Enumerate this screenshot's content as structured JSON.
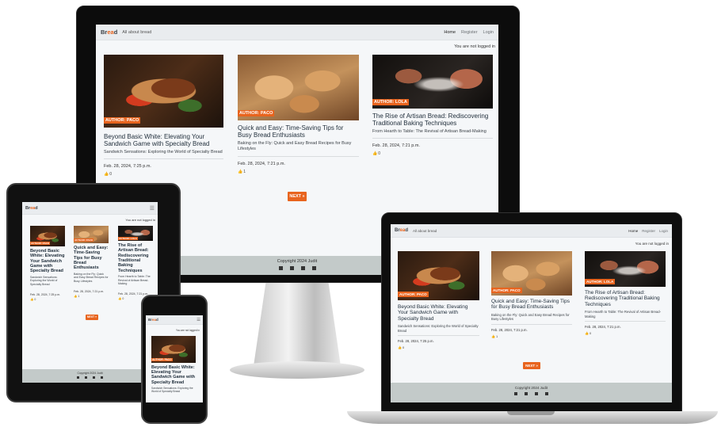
{
  "site": {
    "brand_prefix": "Br",
    "brand_accent": "ea",
    "brand_suffix": "d",
    "tagline": "All about bread",
    "nav": [
      "Home",
      "Register",
      "Login"
    ],
    "login_status": "You are not logged in",
    "next_label": "NEXT »",
    "footer_text": "Copyright 2024 Judit",
    "accent_color": "#e8641e",
    "social_icons": [
      "facebook-icon",
      "instagram-icon",
      "youtube-icon",
      "linkedin-icon"
    ]
  },
  "posts": [
    {
      "author": "AUTHOR: PACO",
      "title": "Beyond Basic White: Elevating Your Sandwich Game with Specialty Bread",
      "excerpt": "Sandwich Sensations: Exploring the World of Specialty Bread",
      "date": "Feb. 28, 2024, 7:25 p.m.",
      "likes": "0",
      "image": "sandwich"
    },
    {
      "author": "AUTHOR: PACO",
      "title": "Quick and Easy: Time-Saving Tips for Busy Bread Enthusiasts",
      "excerpt": "Baking on the Fly: Quick and Easy Bread Recipes for Busy Lifestyles",
      "date": "Feb. 28, 2024, 7:21 p.m.",
      "likes": "1",
      "image": "bread"
    },
    {
      "author": "AUTHOR: LOLA",
      "title": "The Rise of Artisan Bread: Rediscovering Traditional Baking Techniques",
      "excerpt": "From Hearth to Table: The Revival of Artisan Bread-Making",
      "date": "Feb. 28, 2024, 7:21 p.m.",
      "likes": "0",
      "image": "hands"
    }
  ]
}
